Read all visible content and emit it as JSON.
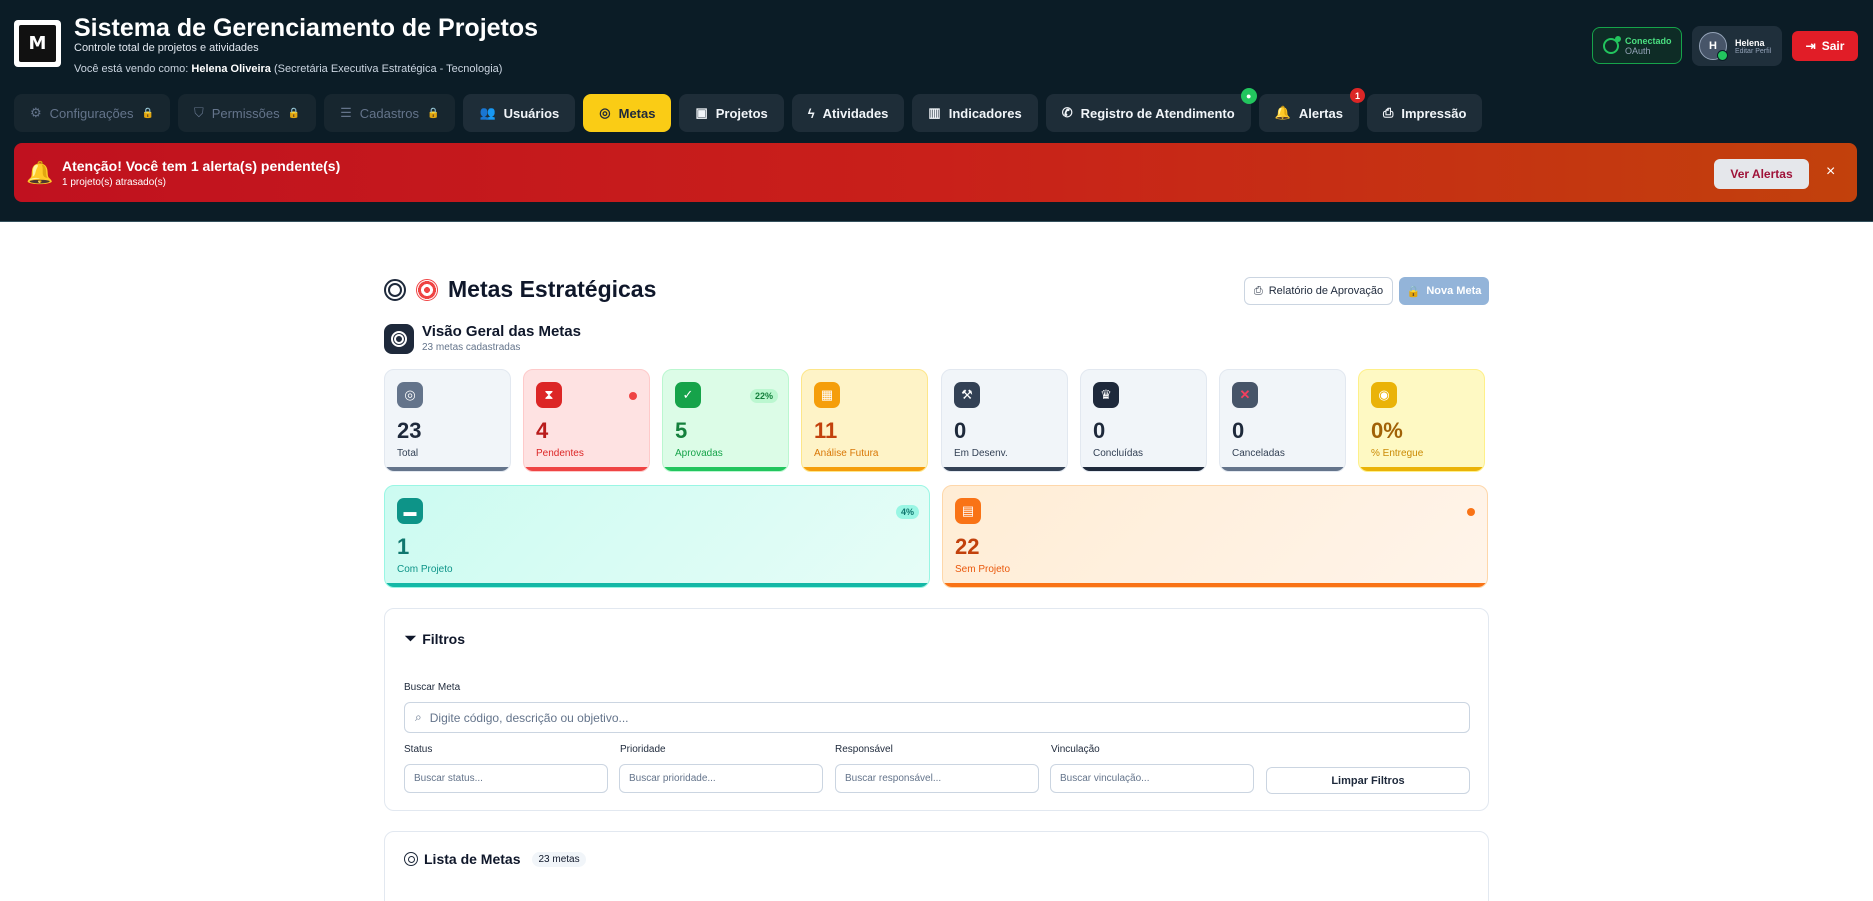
{
  "header": {
    "title": "Sistema de Gerenciamento de Projetos",
    "subtitle": "Controle total de projetos e atividades",
    "viewing_prefix": "Você está vendo como:",
    "viewing_name": "Helena Oliveira",
    "viewing_dept": "(Secretária Executiva Estratégica - Tecnologia)",
    "logo_text": "M",
    "connection": {
      "status": "Conectado",
      "method": "OAuth"
    },
    "user": {
      "initial": "H",
      "name": "Helena",
      "edit": "Editar Perfil"
    },
    "logout_label": "Sair"
  },
  "nav": [
    {
      "label": "Configurações",
      "icon": "gear-icon",
      "disabled": true
    },
    {
      "label": "Permissões",
      "icon": "shield-icon",
      "disabled": true
    },
    {
      "label": "Cadastros",
      "icon": "database-icon",
      "disabled": true
    },
    {
      "label": "Usuários",
      "icon": "users-icon"
    },
    {
      "label": "Metas",
      "icon": "target-icon",
      "active": true
    },
    {
      "label": "Projetos",
      "icon": "folder-icon"
    },
    {
      "label": "Atividades",
      "icon": "bolt-icon"
    },
    {
      "label": "Indicadores",
      "icon": "chart-icon"
    },
    {
      "label": "Registro de Atendimento",
      "icon": "phone-icon"
    },
    {
      "label": "Alertas",
      "icon": "bell-icon",
      "badge": "1"
    },
    {
      "label": "Impressão",
      "icon": "printer-icon"
    }
  ],
  "alert": {
    "title": "Atenção! Você tem 1 alerta(s) pendente(s)",
    "detail": "1 projeto(s) atrasado(s)",
    "button": "Ver Alertas",
    "close": "×"
  },
  "page": {
    "title": "Metas Estratégicas",
    "report_button": "Relatório de Aprovação",
    "new_button": "Nova Meta",
    "overview_title": "Visão Geral das Metas",
    "overview_sub": "23 metas cadastradas"
  },
  "stats": [
    {
      "value": "23",
      "label": "Total",
      "icon": "target-icon",
      "color": "#64748b"
    },
    {
      "value": "4",
      "label": "Pendentes",
      "icon": "hourglass-icon",
      "color": "#dc2626"
    },
    {
      "value": "5",
      "label": "Aprovadas",
      "icon": "check-icon",
      "color": "#16a34a",
      "pct": "22%"
    },
    {
      "value": "11",
      "label": "Análise Futura",
      "icon": "calendar-icon",
      "color": "#f59e0b"
    },
    {
      "value": "0",
      "label": "Em Desenv.",
      "icon": "tools-icon",
      "color": "#334155"
    },
    {
      "value": "0",
      "label": "Concluídas",
      "icon": "trophy-icon",
      "color": "#1e293b"
    },
    {
      "value": "0",
      "label": "Canceladas",
      "icon": "x-icon",
      "color": "#475569"
    },
    {
      "value": "0%",
      "label": "% Entregue",
      "icon": "dart-icon",
      "color": "#eab308"
    }
  ],
  "stats_wide": [
    {
      "value": "1",
      "label": "Com Projeto",
      "icon": "folder-icon",
      "pct": "4%"
    },
    {
      "value": "22",
      "label": "Sem Projeto",
      "icon": "clipboard-icon"
    }
  ],
  "filters": {
    "title": "Filtros",
    "search_label": "Buscar Meta",
    "search_placeholder": "Digite código, descrição ou objetivo...",
    "status_label": "Status",
    "status_placeholder": "Buscar status...",
    "priority_label": "Prioridade",
    "priority_placeholder": "Buscar prioridade...",
    "owner_label": "Responsável",
    "owner_placeholder": "Buscar responsável...",
    "link_label": "Vinculação",
    "link_placeholder": "Buscar vinculação...",
    "clear_button": "Limpar Filtros"
  },
  "list": {
    "title": "Lista de Metas",
    "count": "23 metas"
  }
}
